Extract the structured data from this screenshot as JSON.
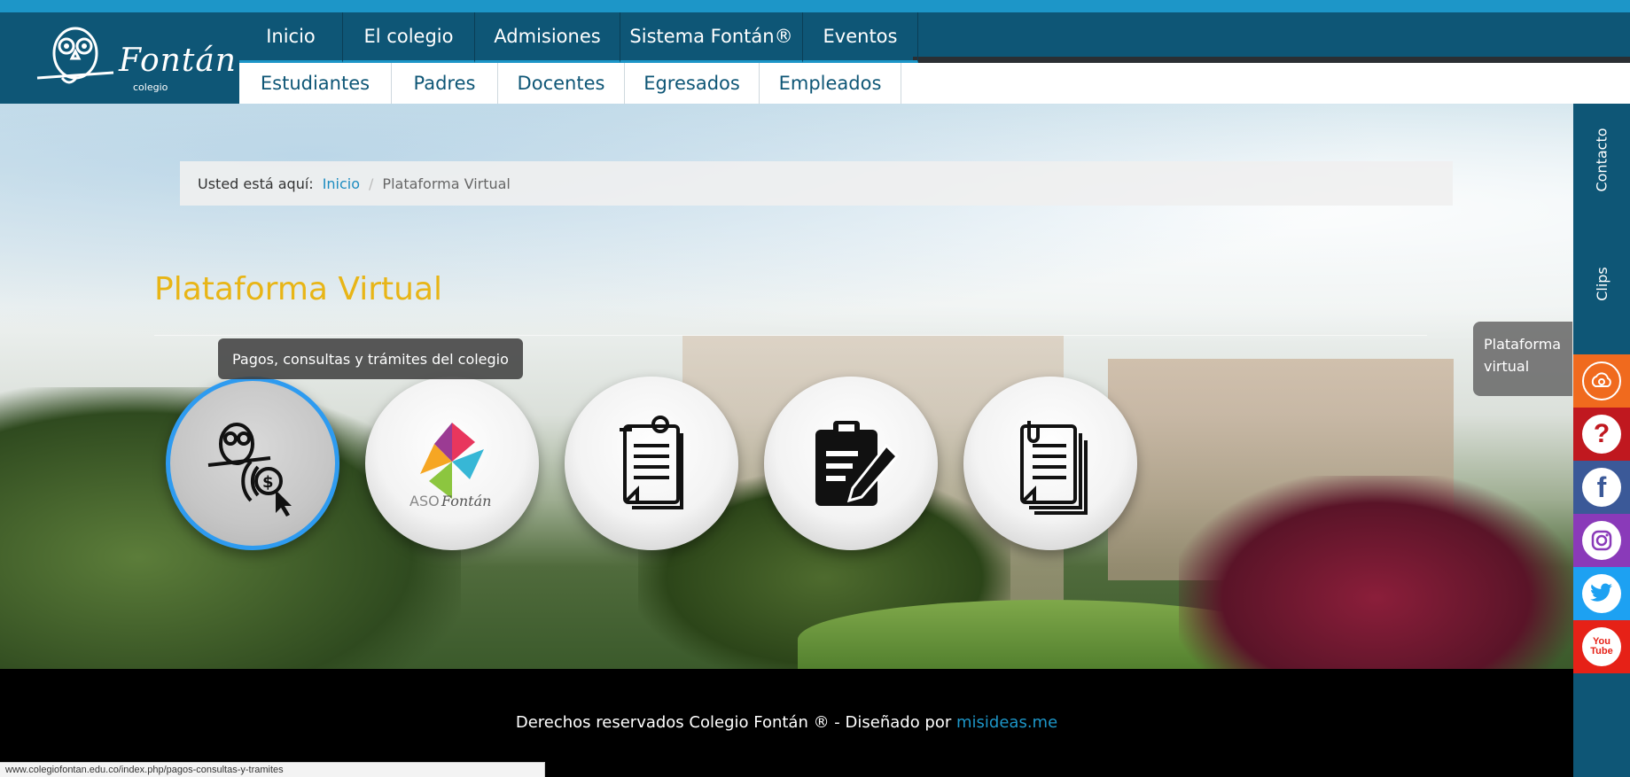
{
  "site": {
    "logo_text": "Fontán",
    "logo_sub": "colegio"
  },
  "nav": {
    "top": [
      "Inicio",
      "El colegio",
      "Admisiones",
      "Sistema Fontán®",
      "Eventos"
    ],
    "bottom": [
      "Estudiantes",
      "Padres",
      "Docentes",
      "Egresados",
      "Empleados"
    ]
  },
  "breadcrumb": {
    "lead": "Usted está aquí:",
    "home": "Inicio",
    "separator": "/",
    "current": "Plataforma Virtual"
  },
  "page": {
    "title": "Plataforma Virtual",
    "tooltip": "Pagos, consultas y trámites del colegio"
  },
  "tiles": [
    {
      "icon": "owl-payment-icon"
    },
    {
      "icon": "aso-fontan-pinwheel-icon",
      "text": "ASO",
      "script": "Fontán"
    },
    {
      "icon": "owl-documents-icon"
    },
    {
      "icon": "clipboard-pencil-icon"
    },
    {
      "icon": "documents-icon"
    }
  ],
  "sidebar": {
    "contact": "Contacto",
    "clips": "Clips",
    "tip": "Plataforma virtual",
    "socials": [
      "cloud-icon",
      "question-icon",
      "facebook-icon",
      "instagram-icon",
      "twitter-icon",
      "youtube-icon"
    ],
    "youtube_text": "You Tube"
  },
  "footer": {
    "text": "Derechos reservados Colegio Fontán ® - Diseñado por",
    "link": "misideas.me"
  },
  "status": {
    "url": "www.colegiofontan.edu.co/index.php/pagos-consultas-y-tramites"
  }
}
